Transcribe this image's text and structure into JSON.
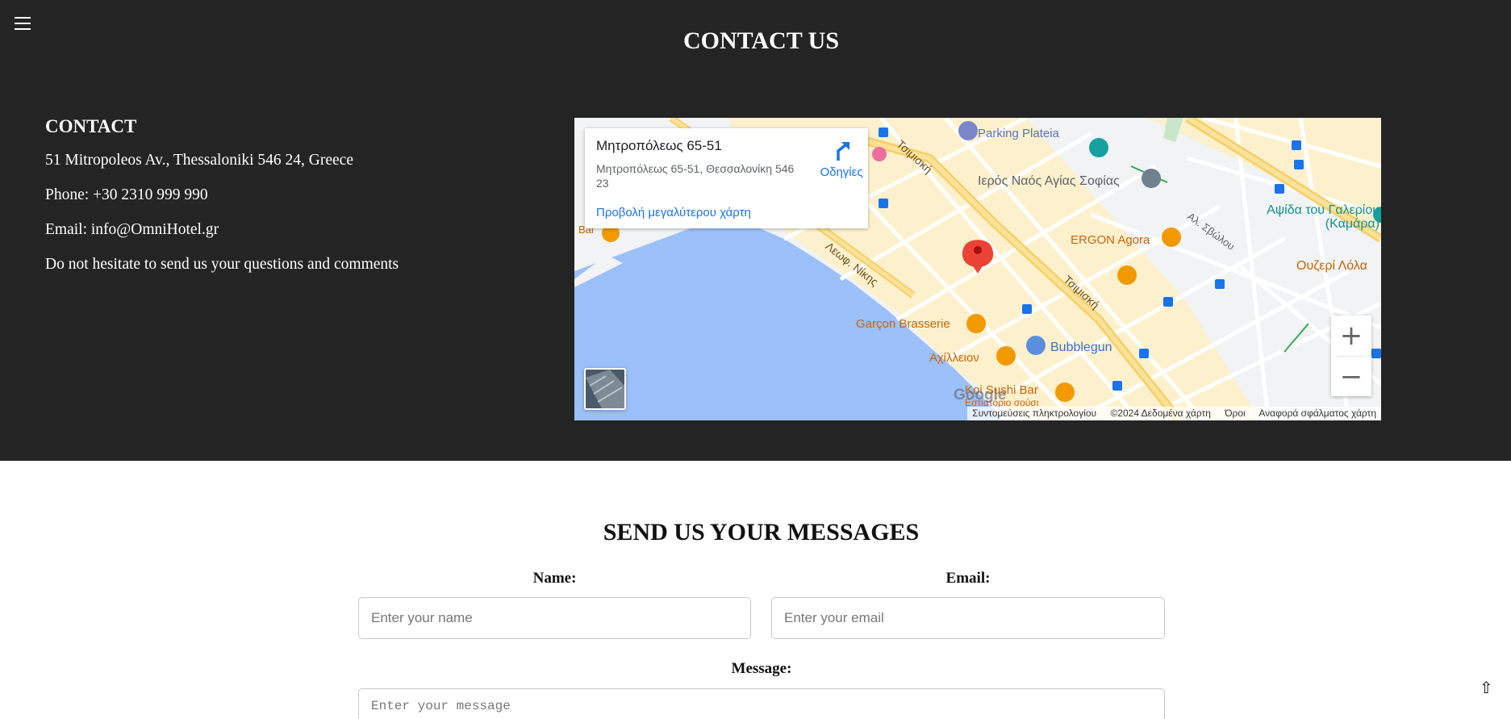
{
  "header": {
    "menu_icon": "hamburger-menu-icon",
    "title": "CONTACT US"
  },
  "contact": {
    "heading": "CONTACT",
    "address": "51 Mitropoleos Av., Thessaloniki 546 24, Greece",
    "phone": "Phone: +30 2310 999 990",
    "email": "Email: info@OmniHotel.gr",
    "note": "Do not hesitate to send us your questions and comments"
  },
  "map": {
    "place_title": "Μητροπόλεως 65-51",
    "place_address": "Μητροπόλεως 65-51, Θεσσαλονίκη 546 23",
    "directions_label": "Οδηγίες",
    "larger_map_link": "Προβολή μεγαλύτερου χάρτη",
    "zoom_in": "+",
    "zoom_out": "−",
    "google_logo": "Google",
    "attribution": {
      "shortcuts": "Συντομεύσεις πληκτρολογίου",
      "data": "©2024 Δεδομένα χάρτη",
      "terms": "Όροι",
      "report": "Αναφορά σφάλματος χάρτη"
    },
    "labels": {
      "parking": "Parking Plateia",
      "church": "Ιερός Ναός Αγίας Σοφίας",
      "ergon": "ERGON Agora",
      "arch": "Αψίδα του Γαλερίου (Καμάρα)",
      "ouzeri": "Ουζερί Λόλα",
      "garcon": "Garçon Brasserie",
      "bubblegun": "Bubblegun",
      "achilleion": "Αχίλλειον",
      "koi": "Koi Sushi Bar",
      "koi_sub": "Εστιατόριο σούσι",
      "tsimiski_1": "Τσιμισκή",
      "tsimiski_2": "Τσιμισκή",
      "nikis": "Λεωφ. Νίκης",
      "svolou": "Αλ. Σβώλου",
      "bar": "Bar"
    }
  },
  "form": {
    "title": "SEND US YOUR MESSAGES",
    "name_label": "Name:",
    "name_placeholder": "Enter your name",
    "email_label": "Email:",
    "email_placeholder": "Enter your email",
    "message_label": "Message:",
    "message_placeholder": "Enter your message"
  },
  "scroll_top": "⇧"
}
